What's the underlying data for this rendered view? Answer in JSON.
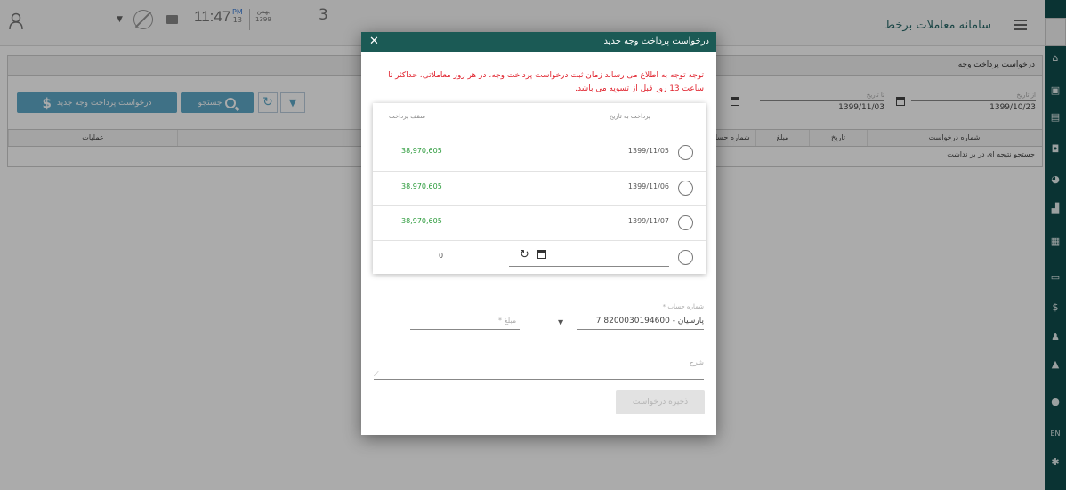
{
  "header": {
    "app_title": "سامانه معاملات برخط",
    "clock": "11:47",
    "ampm_top": "PM",
    "ampm_bottom": "13",
    "date_top": "بهمن",
    "date_bottom": "1399",
    "day_number": "3"
  },
  "page": {
    "title": "درخواست پرداخت وجه",
    "new_request_button": "درخواست پرداخت وجه جدید",
    "search_button": "جستجو",
    "from_date_label": "از تاریخ",
    "from_date_value": "1399/10/23",
    "to_date_label": "تا تاریخ",
    "to_date_value": "1399/11/03",
    "columns": [
      "شماره درخواست",
      "تاریخ",
      "مبلغ",
      "شماره حساب",
      "مبدا درخواست",
      "عملیات"
    ],
    "empty_message": "جستجو نتیجه ای در بر نداشت"
  },
  "dialog": {
    "title": "درخواست پرداخت وجه جدید",
    "notice": "توجه توجه به اطلاع می رساند زمان ثبت درخواست پرداخت وجه، در هر روز معاملاتی، حداکثر تا ساعت 13 روز قبل از تسویه می باشد.",
    "col_date": "پرداخت به تاریخ",
    "col_amount": "سقف پرداخت",
    "rows": [
      {
        "date": "1399/11/05",
        "amount": "38,970,605"
      },
      {
        "date": "1399/11/06",
        "amount": "38,970,605"
      },
      {
        "date": "1399/11/07",
        "amount": "38,970,605"
      }
    ],
    "custom_amount": "0",
    "account_label": "شماره حساب *",
    "account_value": "پارسیان - 8200030194600 7",
    "amount_label": "مبلغ *",
    "description_label": "شرح",
    "submit_button": "ذخیره درخواست"
  },
  "colors": {
    "sidebar": "#0f4d4d",
    "dialog_header": "#1b5a55",
    "button": "#5fa9c8",
    "notice": "#e0202b",
    "amount": "#2a9a3a"
  }
}
